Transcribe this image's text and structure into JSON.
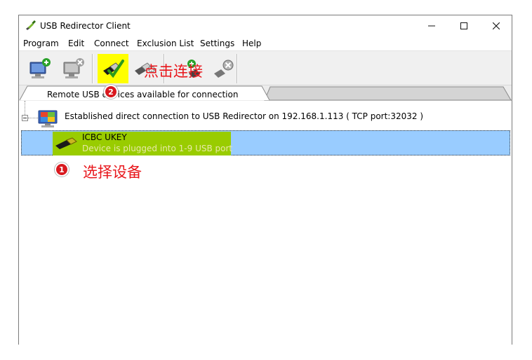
{
  "window": {
    "title": "USB Redirector Client",
    "controls": {
      "minimize": "—",
      "maximize": "☐",
      "close": "✕"
    }
  },
  "menu": [
    "Program",
    "Edit",
    "Connect",
    "Exclusion List",
    "Settings",
    "Help"
  ],
  "toolbar": {
    "buttons": [
      {
        "name": "add-server",
        "icon": "computer-add-icon"
      },
      {
        "name": "remove-server",
        "icon": "computer-remove-icon"
      },
      {
        "name": "connect-device",
        "icon": "usb-connect-icon",
        "highlighted": true
      },
      {
        "name": "disconnect-device",
        "icon": "usb-disconnect-icon"
      },
      {
        "name": "add-exclusion",
        "icon": "exclusion-add-icon"
      },
      {
        "name": "remove-exclusion",
        "icon": "exclusion-remove-icon"
      }
    ],
    "highlight_color": "#ffff00"
  },
  "annotations": {
    "step1": {
      "number": "1",
      "text": "选择设备"
    },
    "step2": {
      "number": "2",
      "text": "点击连接"
    },
    "color": "#e8161b"
  },
  "tabs": {
    "active": "Remote USB devices available for connection"
  },
  "tree": {
    "connection": "Established direct connection to USB Redirector on 192.168.1.113 ( TCP port:32032 )",
    "device": {
      "name": "ICBC UKEY",
      "status": "Device is plugged into 1-9 USB port",
      "selection_color": "#99ccff",
      "highlight_color": "#99cc00"
    }
  }
}
